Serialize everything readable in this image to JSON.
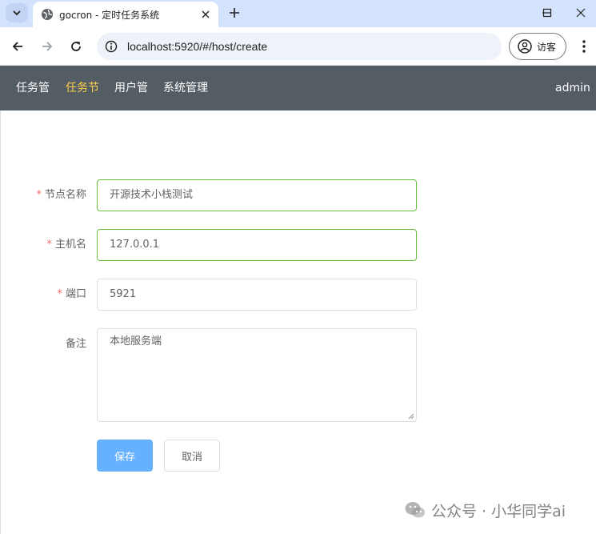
{
  "browser": {
    "tab_title": "gocron - 定时任务系统",
    "url": "localhost:5920/#/host/create",
    "guest_label": "访客"
  },
  "header": {
    "nav": [
      "任务管",
      "任务节",
      "用户管",
      "系统管理"
    ],
    "active_index": 1,
    "user": "admin",
    "bg_color": "#545c64",
    "active_color": "#ffd04b"
  },
  "form": {
    "fields": [
      {
        "label": "节点名称",
        "required": true,
        "value": "开源技术小栈测试"
      },
      {
        "label": "主机名",
        "required": true,
        "value": "127.0.0.1"
      },
      {
        "label": "端口",
        "required": true,
        "value": "5921"
      },
      {
        "label": "备注",
        "required": false,
        "value": "本地服务端"
      }
    ],
    "required_mark": "*",
    "save_label": "保存",
    "cancel_label": "取消",
    "valid_color": "#67c23a",
    "primary_color": "#66b1ff"
  },
  "watermark": {
    "text": "公众号 · 小华同学ai",
    "icon": "wechat-icon"
  }
}
